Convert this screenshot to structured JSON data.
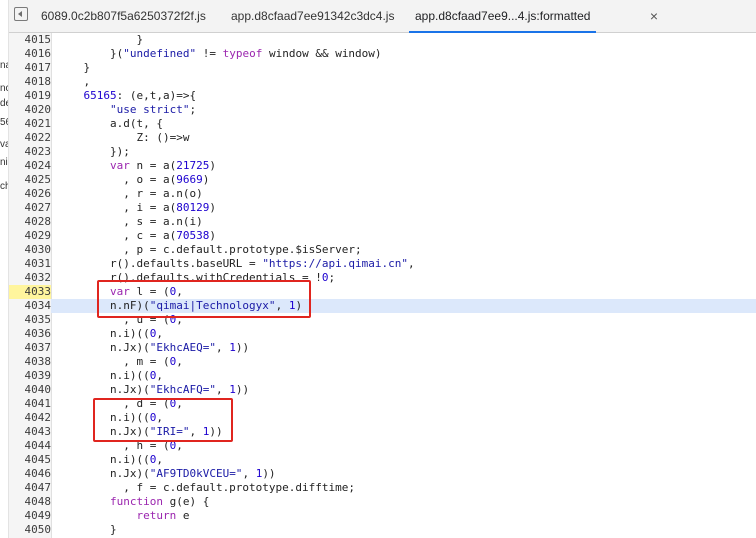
{
  "tabs": [
    {
      "label": "6089.0c2b807f5a6250372f2f.js",
      "active": false
    },
    {
      "label": "app.d8cfaad7ee91342c3dc4.js",
      "active": false
    },
    {
      "label": "app.d8cfaad7ee9...4.js:formatted",
      "active": true
    }
  ],
  "close_glyph": "×",
  "left_strip": [
    "na",
    "nc",
    "de",
    "56",
    "va",
    "ni",
    "ch"
  ],
  "lines": [
    {
      "n": "4015",
      "code": "            }"
    },
    {
      "n": "4016",
      "code": "        }(\"undefined\" != typeof window && window)"
    },
    {
      "n": "4017",
      "code": "    }"
    },
    {
      "n": "4018",
      "code": "    ,"
    },
    {
      "n": "4019",
      "code": "    65165: (e,t,a)=>{"
    },
    {
      "n": "4020",
      "code": "        \"use strict\";"
    },
    {
      "n": "4021",
      "code": "        a.d(t, {"
    },
    {
      "n": "4022",
      "code": "            Z: ()=>w"
    },
    {
      "n": "4023",
      "code": "        });"
    },
    {
      "n": "4024",
      "code": "        var n = a(21725)"
    },
    {
      "n": "4025",
      "code": "          , o = a(9669)"
    },
    {
      "n": "4026",
      "code": "          , r = a.n(o)"
    },
    {
      "n": "4027",
      "code": "          , i = a(80129)"
    },
    {
      "n": "4028",
      "code": "          , s = a.n(i)"
    },
    {
      "n": "4029",
      "code": "          , c = a(70538)"
    },
    {
      "n": "4030",
      "code": "          , p = c.default.prototype.$isServer;"
    },
    {
      "n": "4031",
      "code": "        r().defaults.baseURL = \"https://api.qimai.cn\","
    },
    {
      "n": "4032",
      "code": "        r().defaults.withCredentials = !0;"
    },
    {
      "n": "4033",
      "code": "        var l = (0,"
    },
    {
      "n": "4034",
      "code": "        n.nF)(\"qimai|Technologyx\", 1)"
    },
    {
      "n": "4035",
      "code": "          , u = (0,"
    },
    {
      "n": "4036",
      "code": "        n.i)((0,"
    },
    {
      "n": "4037",
      "code": "        n.Jx)(\"EkhcAEQ=\", 1))"
    },
    {
      "n": "4038",
      "code": "          , m = (0,"
    },
    {
      "n": "4039",
      "code": "        n.i)((0,"
    },
    {
      "n": "4040",
      "code": "        n.Jx)(\"EkhcAFQ=\", 1))"
    },
    {
      "n": "4041",
      "code": "          , d = (0,"
    },
    {
      "n": "4042",
      "code": "        n.i)((0,"
    },
    {
      "n": "4043",
      "code": "        n.Jx)(\"IRI=\", 1))"
    },
    {
      "n": "4044",
      "code": "          , h = (0,"
    },
    {
      "n": "4045",
      "code": "        n.i)((0,"
    },
    {
      "n": "4046",
      "code": "        n.Jx)(\"AF9TD0kVCEU=\", 1))"
    },
    {
      "n": "4047",
      "code": "          , f = c.default.prototype.difftime;"
    },
    {
      "n": "4048",
      "code": "        function g(e) {"
    },
    {
      "n": "4049",
      "code": "            return e"
    },
    {
      "n": "4050",
      "code": "        }"
    }
  ],
  "highlight": {
    "current_line": "4033",
    "selected_line": "4034"
  },
  "colors": {
    "keyword": "#9b26af",
    "string": "#1a1aa6",
    "number": "#1c00cf",
    "annotation_box": "#e0251f",
    "active_tab_underline": "#1a73e8"
  }
}
